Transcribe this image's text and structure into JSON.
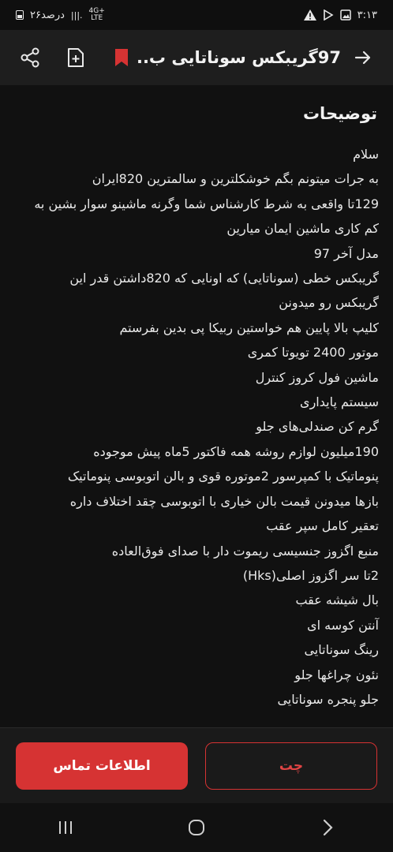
{
  "status_bar": {
    "time": "۳:۱۳",
    "battery_text": "۲۶درصد",
    "network": "4G+",
    "volte": "LTE"
  },
  "header": {
    "title": "97گریبکس سوناتایی ب..."
  },
  "section": {
    "title": "توضیحات"
  },
  "description_lines": [
    "سلام",
    "به جرات میتونم بگم خوشکلترین و سالمترین 820ایران",
    "129تا واقعی به شرط کارشناس شما وگرنه ماشینو سوار بشین به",
    "کم کاری ماشین ایمان میارین",
    "مدل آخر 97",
    "گریبکس خطی (سوناتایی) که اونایی که 820داشتن قدر این",
    "گریبکس رو میدونن",
    "کلیپ بالا پایین هم خواستین ربیکا پی بدین بفرستم",
    "موتور 2400 تویوتا کمری",
    "ماشین فول کروز کنترل",
    "سیستم پایداری",
    "گرم کن صندلی‌های جلو",
    "190میلیون لوازم روشه همه فاکتور 5ماه پیش موجوده",
    "پنوماتیک با کمپرسور 2موتوره قوی و بالن اتوبوسی پنوماتیک",
    "بازها میدونن قیمت بالن خیاری با اتوبوسی چقد اختلاف داره",
    "تعقیر کامل سپر عقب",
    "منبع اگزوز جنسیسی ریموت دار با صدای فوق‌العاده",
    "2تا سر اگزوز اصلی(Hks)",
    "بال شیشه عقب",
    "آنتن کوسه ای",
    "رینگ سوناتایی",
    "نئون چراغها جلو",
    "جلو پنجره سوناتایی"
  ],
  "actions": {
    "contact_label": "اطلاعات تماس",
    "chat_label": "چت"
  },
  "colors": {
    "accent": "#d63333",
    "background": "#111111",
    "appbar": "#1e1e1e"
  }
}
